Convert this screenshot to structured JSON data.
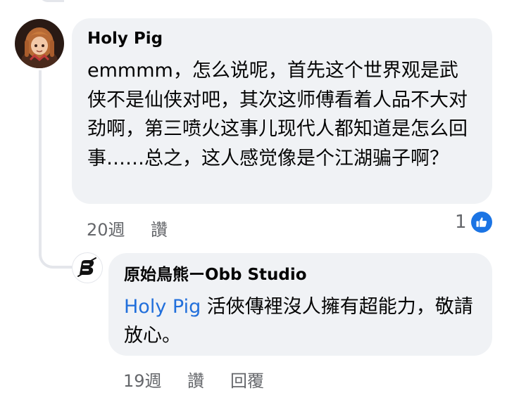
{
  "comment": {
    "author": "Holy Pig",
    "text": "emmmm，怎么说呢，首先这个世界观是武侠不是仙侠对吧，其次这师傅看着人品不大对劲啊，第三喷火这事儿现代人都知道是怎么回事……总之，这人感觉像是个江湖骗子啊？",
    "time": "20週",
    "like_label": "讚",
    "reaction_count": "1",
    "reaction_icon": "like-thumb-icon"
  },
  "reply": {
    "author": "原始鳥熊ーObb Studio",
    "mention": "Holy Pig",
    "text": " 活俠傳裡沒人擁有超能力，敬請放心。",
    "time": "19週",
    "like_label": "讚",
    "reply_label": "回覆"
  },
  "colors": {
    "bubble": "#f0f2f5",
    "mention": "#216fdb",
    "meta": "#65676b",
    "like_blue": "#1b74e4"
  }
}
